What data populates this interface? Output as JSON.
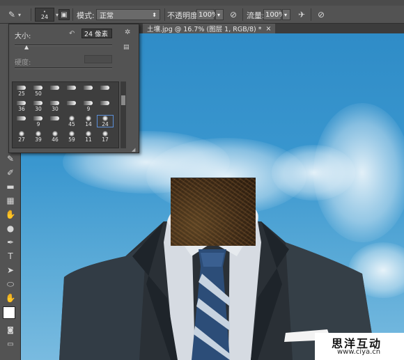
{
  "options_bar": {
    "brush_size": "24",
    "mode_label": "模式:",
    "mode_value": "正常",
    "opacity_label": "不透明度:",
    "opacity_value": "100%",
    "flow_label": "流量:",
    "flow_value": "100%"
  },
  "document_tab": {
    "title": "土壤.jpg @ 16.7% (图层 1, RGB/8) *",
    "close": "×"
  },
  "brush_panel": {
    "size_label": "大小:",
    "size_value": "24 像素",
    "hardness_label": "硬度:",
    "presets": [
      [
        "25",
        "50",
        "",
        "",
        "",
        ""
      ],
      [
        "36",
        "30",
        "30",
        "",
        "9",
        ""
      ],
      [
        "",
        "9",
        "",
        "45",
        "14",
        "24"
      ],
      [
        "27",
        "39",
        "46",
        "59",
        "11",
        "17"
      ]
    ]
  },
  "tools": [
    "lasso-tool",
    "brush-tool",
    "eraser-tool",
    "gradient-tool",
    "smudge-tool",
    "dodge-tool",
    "pen-tool",
    "type-tool",
    "path-select-tool",
    "shape-tool",
    "hand-tool",
    "zoom-tool"
  ],
  "tool_glyphs": [
    "✎",
    "✐",
    "▬",
    "▦",
    "✋",
    "●",
    "✒",
    "T",
    "➤",
    "⬭",
    "✋",
    "🔍"
  ],
  "watermark": {
    "title": "思洋互动",
    "url": "www.ciya.cn"
  },
  "colors": {
    "foreground": "#000000",
    "background": "#ffffff",
    "sky": "#3a97cf"
  }
}
